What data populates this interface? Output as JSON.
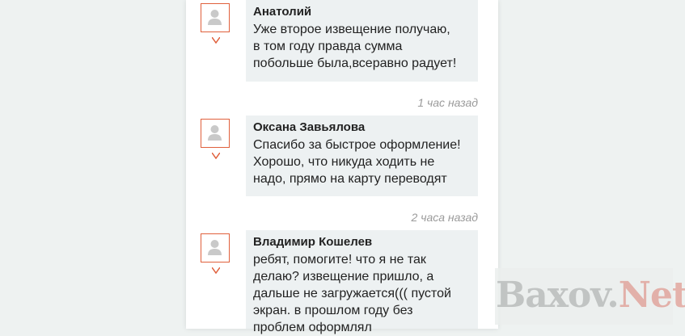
{
  "comments": [
    {
      "author": "Анатолий",
      "text": "Уже второе извещение получаю,\nв том году правда сумма\nпобольше была,всеравно радует!",
      "time": "1 час назад"
    },
    {
      "author": "Оксана Завьялова",
      "text": "Спасибо за быстрое оформление!\nХорошо, что никуда ходить не\nнадо, прямо на карту переводят",
      "time": "2 часа назад"
    },
    {
      "author": "Владимир Кошелев",
      "text": "ребят, помогите! что я не так\nделаю? извещение пришло, а\nдальше не загружается((( пустой\nэкран. в прошлом году без\nпроблем оформлял",
      "time": ""
    }
  ],
  "watermark": {
    "part1": "Baxov.",
    "part2": "Net"
  },
  "colors": {
    "avatar_border": "#e0603c",
    "bubble_bg": "#edf1f2",
    "page_bg": "#eef2f1"
  }
}
